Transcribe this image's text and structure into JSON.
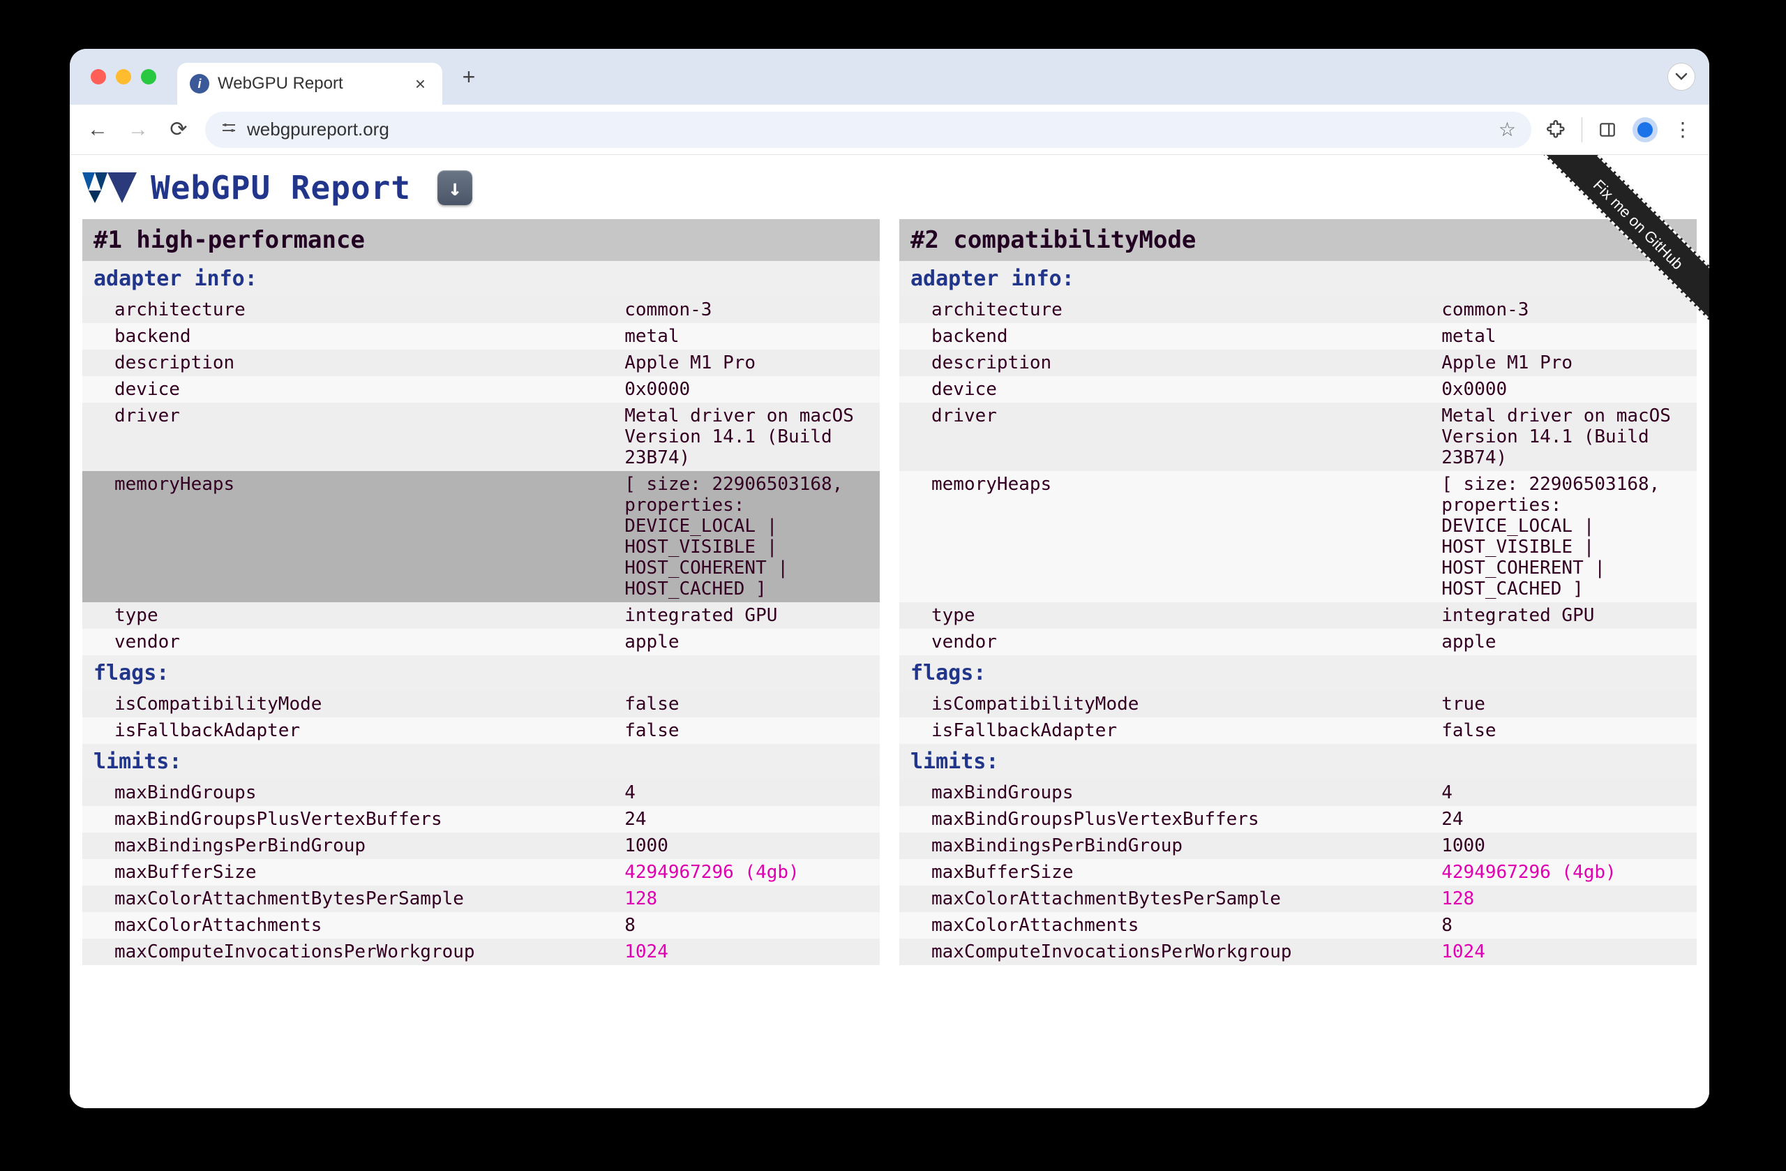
{
  "browser": {
    "tab_title": "WebGPU Report",
    "url": "webgpureport.org"
  },
  "page_title": "WebGPU  Report",
  "download_icon": "download-icon",
  "ribbon_text": "Fix me on GitHub",
  "columns": [
    {
      "header": "#1 high-performance",
      "sections": [
        {
          "title": "adapter info:",
          "rows": [
            {
              "k": "architecture",
              "v": "common-3"
            },
            {
              "k": "backend",
              "v": "metal"
            },
            {
              "k": "description",
              "v": "Apple M1 Pro"
            },
            {
              "k": "device",
              "v": "0x0000"
            },
            {
              "k": "driver",
              "v": "Metal driver on macOS Version 14.1 (Build 23B74)"
            },
            {
              "k": "memoryHeaps",
              "v": "[ size: 22906503168, properties: DEVICE_LOCAL | HOST_VISIBLE | HOST_COHERENT | HOST_CACHED ]",
              "hl": true
            },
            {
              "k": "type",
              "v": "integrated GPU"
            },
            {
              "k": "vendor",
              "v": "apple"
            }
          ]
        },
        {
          "title": "flags:",
          "rows": [
            {
              "k": "isCompatibilityMode",
              "v": "false"
            },
            {
              "k": "isFallbackAdapter",
              "v": "false"
            }
          ]
        },
        {
          "title": "limits:",
          "rows": [
            {
              "k": "maxBindGroups",
              "v": "4"
            },
            {
              "k": "maxBindGroupsPlusVertexBuffers",
              "v": "24"
            },
            {
              "k": "maxBindingsPerBindGroup",
              "v": "1000"
            },
            {
              "k": "maxBufferSize",
              "v": "4294967296 (4gb)",
              "pink": true
            },
            {
              "k": "maxColorAttachmentBytesPerSample",
              "v": "128",
              "pink": true
            },
            {
              "k": "maxColorAttachments",
              "v": "8"
            },
            {
              "k": "maxComputeInvocationsPerWorkgroup",
              "v": "1024",
              "pink": true
            }
          ]
        }
      ]
    },
    {
      "header": "#2 compatibilityMode",
      "sections": [
        {
          "title": "adapter info:",
          "rows": [
            {
              "k": "architecture",
              "v": "common-3"
            },
            {
              "k": "backend",
              "v": "metal"
            },
            {
              "k": "description",
              "v": "Apple M1 Pro"
            },
            {
              "k": "device",
              "v": "0x0000"
            },
            {
              "k": "driver",
              "v": "Metal driver on macOS Version 14.1 (Build 23B74)"
            },
            {
              "k": "memoryHeaps",
              "v": "[ size: 22906503168, properties: DEVICE_LOCAL | HOST_VISIBLE | HOST_COHERENT | HOST_CACHED ]"
            },
            {
              "k": "type",
              "v": "integrated GPU"
            },
            {
              "k": "vendor",
              "v": "apple"
            }
          ]
        },
        {
          "title": "flags:",
          "rows": [
            {
              "k": "isCompatibilityMode",
              "v": "true"
            },
            {
              "k": "isFallbackAdapter",
              "v": "false"
            }
          ]
        },
        {
          "title": "limits:",
          "rows": [
            {
              "k": "maxBindGroups",
              "v": "4"
            },
            {
              "k": "maxBindGroupsPlusVertexBuffers",
              "v": "24"
            },
            {
              "k": "maxBindingsPerBindGroup",
              "v": "1000"
            },
            {
              "k": "maxBufferSize",
              "v": "4294967296 (4gb)",
              "pink": true
            },
            {
              "k": "maxColorAttachmentBytesPerSample",
              "v": "128",
              "pink": true
            },
            {
              "k": "maxColorAttachments",
              "v": "8"
            },
            {
              "k": "maxComputeInvocationsPerWorkgroup",
              "v": "1024",
              "pink": true
            }
          ]
        }
      ]
    }
  ]
}
